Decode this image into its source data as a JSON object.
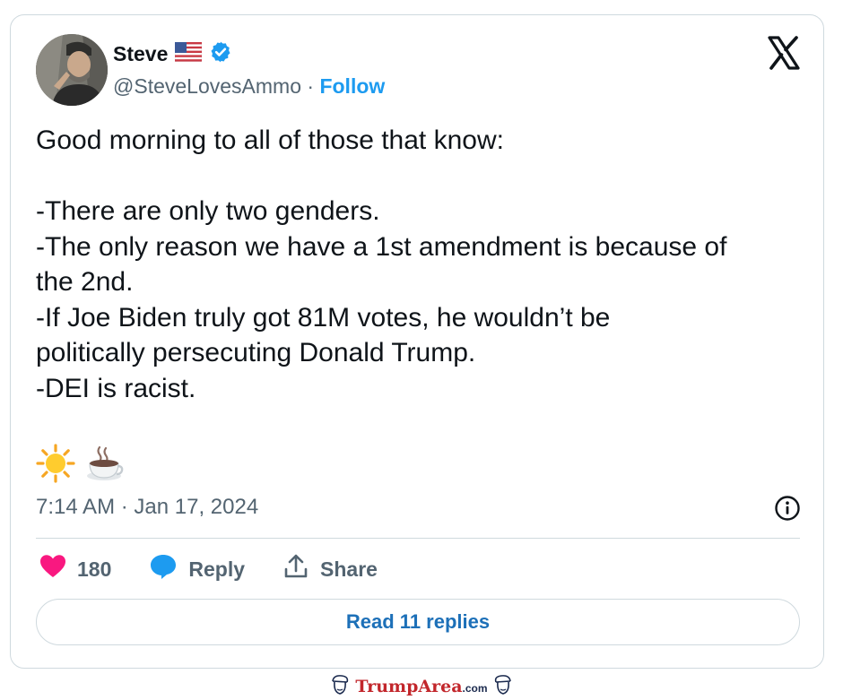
{
  "author": {
    "name": "Steve",
    "flag_icon": "us-flag-icon",
    "verified_icon": "verified-badge-icon",
    "handle": "@SteveLovesAmmo",
    "separator": " · ",
    "follow_label": "Follow"
  },
  "brand": {
    "logo_icon": "x-logo-icon",
    "accent_color": "#1d9bf0"
  },
  "tweet": {
    "lines": [
      "Good morning to all of those that know:",
      "",
      "-There are only two genders.",
      "-The only reason we have a 1st amendment is because of",
      "the 2nd.",
      "-If Joe Biden truly got 81M votes, he wouldn’t be",
      "politically persecuting Donald Trump.",
      "-DEI is racist."
    ],
    "emojis": [
      "sun-emoji",
      "hot-beverage-emoji"
    ],
    "timestamp": "7:14 AM · Jan 17, 2024",
    "info_icon": "info-icon"
  },
  "actions": {
    "like_count": "180",
    "like_color": "#f91880",
    "reply_label": "Reply",
    "share_label": "Share",
    "read_replies_label": "Read 11 replies"
  },
  "watermark": {
    "text": "TrumpArea",
    "tld": ".com"
  }
}
